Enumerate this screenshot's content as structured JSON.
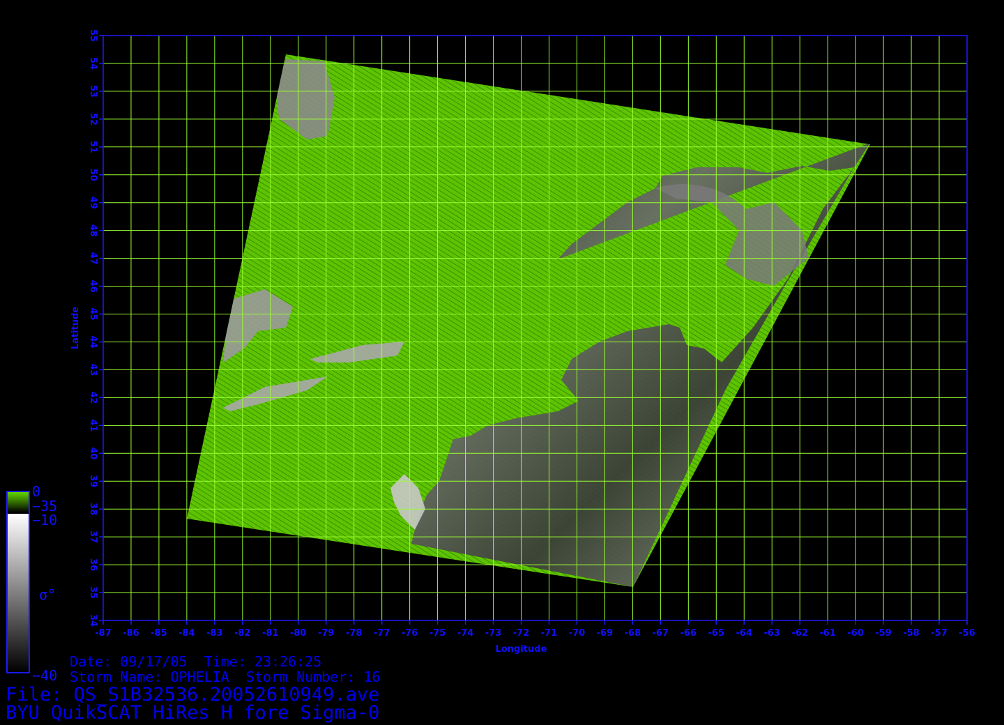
{
  "map": {
    "lon_ticks": [
      -87,
      -86,
      -85,
      -84,
      -83,
      -82,
      -81,
      -80,
      -79,
      -78,
      -77,
      -76,
      -75,
      -74,
      -73,
      -72,
      -71,
      -70,
      -69,
      -68,
      -67,
      -66,
      -65,
      -64,
      -63,
      -62,
      -61,
      -60,
      -59,
      -58,
      -57,
      -56
    ],
    "lat_ticks": [
      34,
      35,
      36,
      37,
      38,
      39,
      40,
      41,
      42,
      43,
      44,
      45,
      46,
      47,
      48,
      49,
      50,
      51,
      52,
      53,
      54,
      55
    ],
    "lon_range": [
      -87,
      -56
    ],
    "lat_range": [
      34,
      55
    ],
    "xlabel": "Longitude",
    "ylabel": "Latitude",
    "grid": true,
    "grid_color": "#9cff33",
    "axis_color": "#1a1aff",
    "swath_colors": {
      "land": "#5cc400",
      "ocean_light": "#d8d8d8",
      "ocean_dark": "#1a1a1a"
    }
  },
  "colorbar": {
    "label_top": "0",
    "label_upper": "−35",
    "label_mid": "−10",
    "label_bottom": "−40",
    "symbol": "σ°",
    "green_range": [
      -35,
      0
    ],
    "gray_range": [
      -40,
      -10
    ]
  },
  "info": {
    "date_line": "Date: 09/17/05  Time: 23:26:25",
    "storm_line": "Storm Name: OPHELIA  Storm Number: 16",
    "file_line": "File: QS_S1B32536.20052610949.ave",
    "product_line": "BYU QuikSCAT HiRes H fore Sigma-0"
  }
}
